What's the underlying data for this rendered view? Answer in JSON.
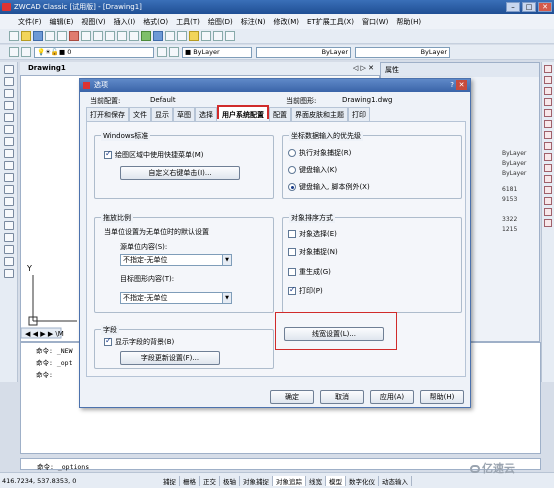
{
  "window": {
    "title": "ZWCAD Classic [试用版] - [Drawing1]"
  },
  "menu": [
    "文件(F)",
    "编辑(E)",
    "视图(V)",
    "插入(I)",
    "格式(O)",
    "工具(T)",
    "绘图(D)",
    "标注(N)",
    "修改(M)",
    "ET扩展工具(X)",
    "窗口(W)",
    "帮助(H)"
  ],
  "toolbar": {
    "layer_value": "0",
    "bylayer_color": "ByLayer",
    "bylayer_linetype": "ByLayer",
    "bylayer_lineweight": "ByLayer"
  },
  "drawing_tab": {
    "label": "Drawing1",
    "nav": "◁ ▷ ✕"
  },
  "properties": {
    "title": "属性",
    "values": [
      "ByLayer",
      "ByLayer",
      "ByLayer",
      "6181",
      "9153",
      "3322",
      "1215"
    ]
  },
  "command": {
    "lines": [
      "命令: _NEW",
      "命令: _opt",
      "命令:"
    ],
    "last": "命令: _options"
  },
  "status": {
    "coords": "416.7234,  537.8353, 0",
    "buttons": [
      "捕捉",
      "栅格",
      "正交",
      "极轴",
      "对象捕捉",
      "对象追踪",
      "线宽",
      "模型",
      "数字化仪",
      "动态输入"
    ]
  },
  "dialog": {
    "title": "选项",
    "current_profile_label": "当前配置:",
    "current_profile": "Default",
    "current_drawing_label": "当前图形:",
    "current_drawing": "Drawing1.dwg",
    "tabs": [
      "打开和保存",
      "文件",
      "显示",
      "草图",
      "选择",
      "用户系统配置",
      "配置",
      "界面皮肤和主题",
      "打印"
    ],
    "windows_std": {
      "title": "Windows标准",
      "shortcut_menu": "绘图区域中使用快捷菜单(M)",
      "custom_right_click": "自定义右键单击(I)..."
    },
    "coord_priority": {
      "title": "坐标数据输入的优先级",
      "options": [
        "执行对象捕捉(R)",
        "键盘输入(K)",
        "键盘输入, 脚本例外(X)"
      ]
    },
    "insert_scale": {
      "title": "拖放比例",
      "subtitle": "当单位设置为无单位时的默认设置",
      "source_label": "源单位内容(S):",
      "source_value": "不指定-无单位",
      "target_label": "目标图形内容(T):",
      "target_value": "不指定-无单位"
    },
    "object_sort": {
      "title": "对象排序方式",
      "options": [
        "对象选择(E)",
        "对象捕捉(N)",
        "重生成(G)",
        "打印(P)"
      ]
    },
    "lineweight_btn": "线宽设置(L)...",
    "fields": {
      "title": "字段",
      "show_bg": "显示字段的背景(B)",
      "update_btn": "字段更新设置(F)..."
    },
    "buttons": {
      "ok": "确定",
      "cancel": "取消",
      "apply": "应用(A)",
      "help": "帮助(H)"
    }
  },
  "watermark": "亿速云"
}
